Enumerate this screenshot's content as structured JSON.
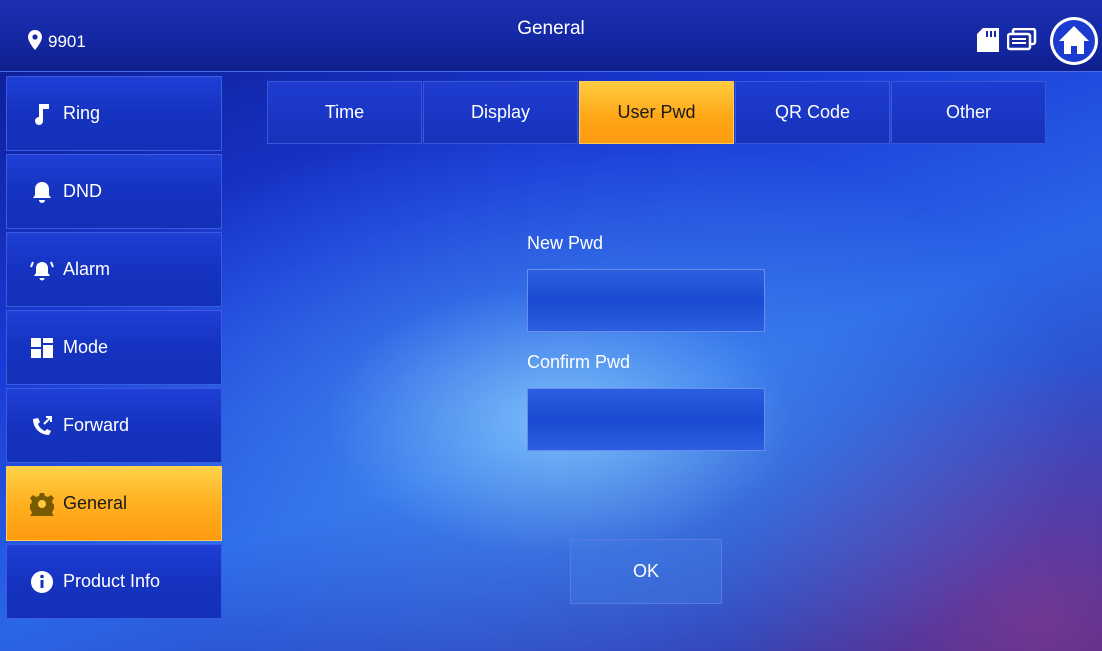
{
  "header": {
    "location": "9901",
    "title": "General",
    "icons": [
      "location-pin-icon",
      "sd-card-icon",
      "monitor-icon",
      "home-icon"
    ]
  },
  "sidebar": {
    "items": [
      {
        "label": "Ring",
        "icon": "music-note-icon",
        "active": false
      },
      {
        "label": "DND",
        "icon": "bell-icon",
        "active": false
      },
      {
        "label": "Alarm",
        "icon": "alarm-icon",
        "active": false
      },
      {
        "label": "Mode",
        "icon": "mode-grid-icon",
        "active": false
      },
      {
        "label": "Forward",
        "icon": "call-forward-icon",
        "active": false
      },
      {
        "label": "General",
        "icon": "gear-icon",
        "active": true
      },
      {
        "label": "Product Info",
        "icon": "info-icon",
        "active": false
      }
    ]
  },
  "tabs": [
    {
      "label": "Time",
      "active": false
    },
    {
      "label": "Display",
      "active": false
    },
    {
      "label": "User Pwd",
      "active": true
    },
    {
      "label": "QR Code",
      "active": false
    },
    {
      "label": "Other",
      "active": false
    }
  ],
  "form": {
    "new_pwd_label": "New Pwd",
    "new_pwd_value": "",
    "confirm_pwd_label": "Confirm Pwd",
    "confirm_pwd_value": "",
    "ok_label": "OK"
  },
  "colors": {
    "active_accent": "#ffb020",
    "panel_blue": "#1533c0"
  }
}
